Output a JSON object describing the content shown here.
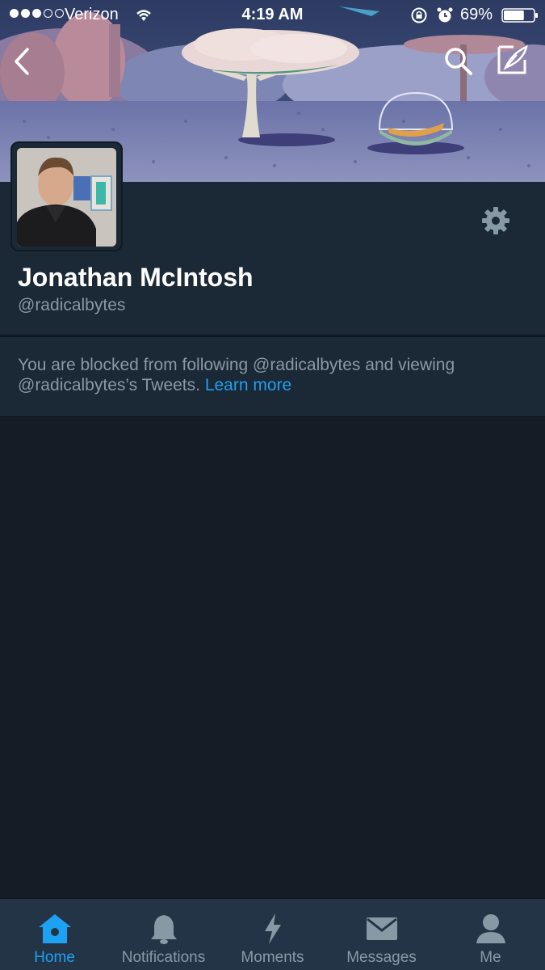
{
  "status_bar": {
    "carrier": "Verizon",
    "time": "4:19 AM",
    "battery": "69%",
    "battery_level": 0.69,
    "signal_bars_filled": 3,
    "signal_bars_total": 5
  },
  "profile": {
    "display_name": "Jonathan McIntosh",
    "handle": "@radicalbytes"
  },
  "blocked_notice": {
    "message": "You are blocked from following @radicalbytes and viewing @radicalbytes’s Tweets.",
    "link": "Learn more"
  },
  "tab_bar": {
    "tabs": [
      {
        "label": "Home",
        "icon": "home-icon",
        "active": true
      },
      {
        "label": "Notifications",
        "icon": "bell-icon",
        "active": false
      },
      {
        "label": "Moments",
        "icon": "lightning-icon",
        "active": false
      },
      {
        "label": "Messages",
        "icon": "envelope-icon",
        "active": false
      },
      {
        "label": "Me",
        "icon": "person-icon",
        "active": false
      }
    ]
  },
  "colors": {
    "background": "#141d26",
    "panel": "#1b2836",
    "tab_bar": "#243447",
    "accent": "#1da1f2",
    "muted_text": "#8899a6"
  }
}
